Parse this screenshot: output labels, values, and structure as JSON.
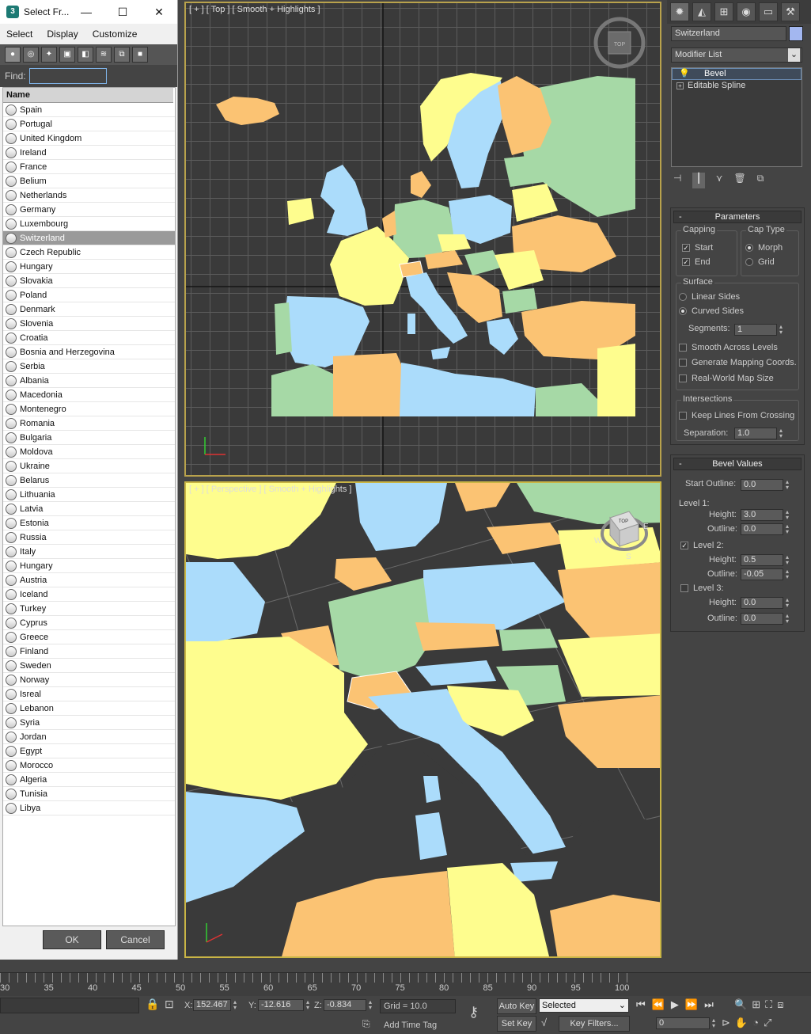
{
  "dialog": {
    "title": "Select Fr...",
    "menu": [
      "Select",
      "Display",
      "Customize"
    ],
    "find_label": "Find:",
    "find_value": "",
    "list_header": "Name",
    "items": [
      "Spain",
      "Portugal",
      "United Kingdom",
      "Ireland",
      "France",
      "Belium",
      "Netherlands",
      "Germany",
      "Luxembourg",
      "Switzerland",
      "Czech Republic",
      "Hungary",
      "Slovakia",
      "Poland",
      "Denmark",
      "Slovenia",
      "Croatia",
      "Bosnia and Herzegovina",
      "Serbia",
      "Albania",
      "Macedonia",
      "Montenegro",
      "Romania",
      "Bulgaria",
      "Moldova",
      "Ukraine",
      "Belarus",
      "Lithuania",
      "Latvia",
      "Estonia",
      "Russia",
      "Italy",
      "Hungary",
      "Austria",
      "Iceland",
      "Turkey",
      "Cyprus",
      "Greece",
      "Finland",
      "Sweden",
      "Norway",
      "Isreal",
      "Lebanon",
      "Syria",
      "Jordan",
      "Egypt",
      "Morocco",
      "Algeria",
      "Tunisia",
      "Libya"
    ],
    "selected": "Switzerland",
    "ok": "OK",
    "cancel": "Cancel"
  },
  "viewports": {
    "top_label": "[ + ] [ Top ] [ Smooth + Highlights ]",
    "persp_label": "[ + ] [ Perspective ] [ Smooth + Highlights ]",
    "viewcube_top": "TOP",
    "compass": [
      "W",
      "E",
      "S"
    ]
  },
  "colors": {
    "yellow": "#fefd8e",
    "blue": "#abdcfb",
    "green": "#a6d9a6",
    "orange": "#fbc373",
    "sea": "#3a3a3a"
  },
  "command_panel": {
    "object_name": "Switzerland",
    "object_color": "#a3b7f0",
    "modifier_list": "Modifier List",
    "stack": [
      "Bevel",
      "Editable Spline"
    ],
    "parameters": {
      "title": "Parameters",
      "capping": "Capping",
      "start": "Start",
      "end": "End",
      "cap_type": "Cap Type",
      "morph": "Morph",
      "grid": "Grid",
      "surface": "Surface",
      "linear": "Linear Sides",
      "curved": "Curved Sides",
      "segments_label": "Segments:",
      "segments": "1",
      "smooth": "Smooth Across Levels",
      "mapping": "Generate Mapping Coords.",
      "realworld": "Real-World Map Size",
      "intersections": "Intersections",
      "keep_lines": "Keep Lines From Crossing",
      "separation_label": "Separation:",
      "separation": "1.0"
    },
    "bevel": {
      "title": "Bevel Values",
      "start_outline_label": "Start Outline:",
      "start_outline": "0.0",
      "level1": "Level 1:",
      "l1_height": "3.0",
      "l1_outline": "0.0",
      "level2": "Level 2:",
      "l2_height": "0.5",
      "l2_outline": "-0.05",
      "level3": "Level 3:",
      "l3_height": "0.0",
      "l3_outline": "0.0",
      "height_label": "Height:",
      "outline_label": "Outline:"
    }
  },
  "timeline": {
    "ticks": [
      "30",
      "35",
      "40",
      "45",
      "50",
      "55",
      "60",
      "65",
      "70",
      "75",
      "80",
      "85",
      "90",
      "95",
      "100"
    ]
  },
  "status": {
    "x_label": "X:",
    "x": "152.467",
    "y_label": "Y:",
    "y": "-12.616",
    "z_label": "Z:",
    "z": "-0.834",
    "grid": "Grid = 10.0",
    "auto_key": "Auto Key",
    "selected": "Selected",
    "set_key": "Set Key",
    "key_filters": "Key Filters...",
    "add_time_tag": "Add Time Tag",
    "frame": "0"
  }
}
